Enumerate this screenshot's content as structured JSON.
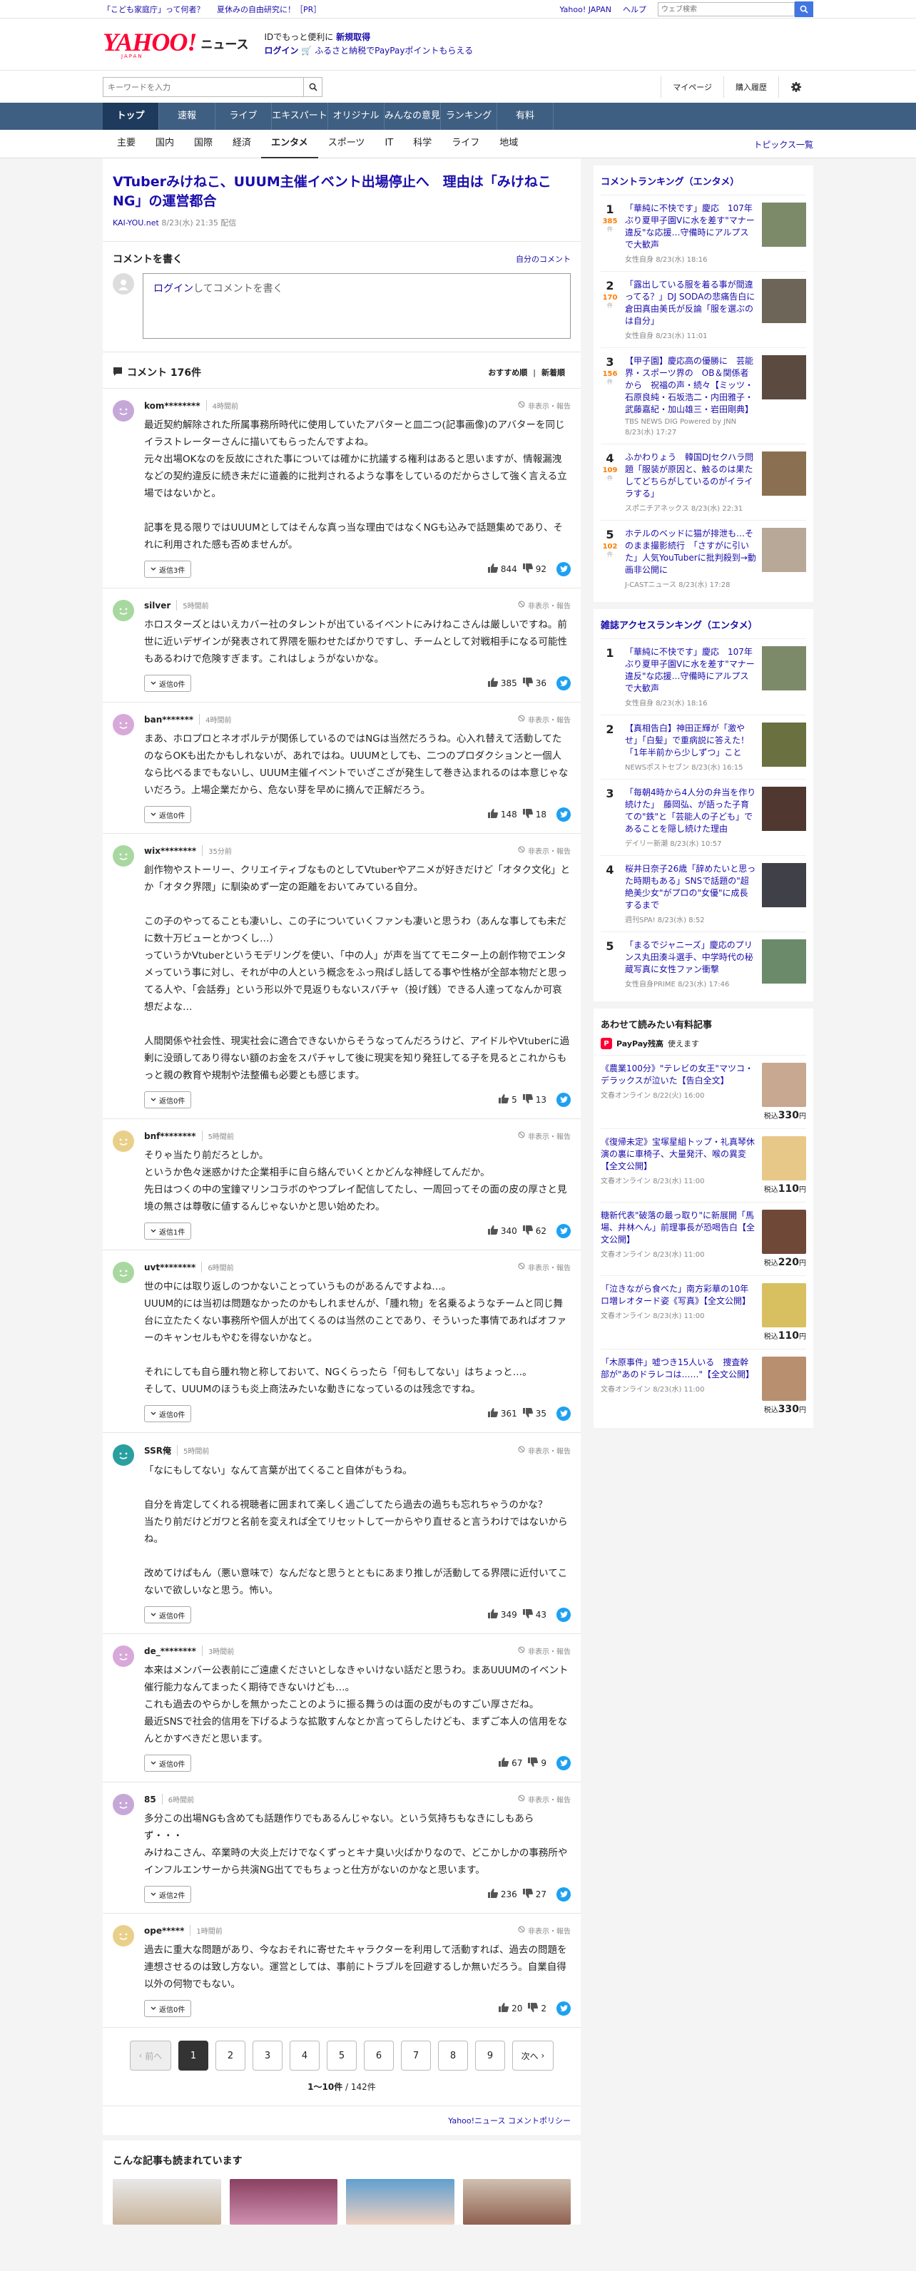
{
  "util": {
    "promo1": "「こども家庭庁」って何者？",
    "promo2": "夏休みの自由研究に！［PR］",
    "yahoo_japan": "Yahoo! JAPAN",
    "help": "ヘルプ",
    "web_search_placeholder": "ウェブ検索"
  },
  "header": {
    "logo_text": "YAHOO!",
    "logo_sub": "JAPAN",
    "logo_news": "ニュース",
    "msg_line1_a": "IDでもっと便利に",
    "msg_line1_b": "新規取得",
    "msg_line2_a": "ログイン",
    "msg_line2_b": "ふるさと納税でPayPayポイントもらえる"
  },
  "search": {
    "placeholder": "キーワードを入力",
    "mypage": "マイページ",
    "history": "購入履歴"
  },
  "gnav": [
    "トップ",
    "速報",
    "ライブ",
    "エキスパート",
    "オリジナル",
    "みんなの意見",
    "ランキング",
    "有料"
  ],
  "snav": {
    "items": [
      "主要",
      "国内",
      "国際",
      "経済",
      "エンタメ",
      "スポーツ",
      "IT",
      "科学",
      "ライフ",
      "地域"
    ],
    "topics": "トピックス一覧"
  },
  "article": {
    "title": "VTuberみけねこ、UUUM主催イベント出場停止へ　理由は「みけねこNG」の運営都合",
    "source": "KAI-YOU.net",
    "date": "8/23(水) 21:35 配信"
  },
  "comment_write": {
    "heading": "コメントを書く",
    "my_comments": "自分のコメント",
    "login": "ログイン",
    "prompt": "してコメントを書く"
  },
  "comment_list": {
    "title": "コメント 176件",
    "sort_recommended": "おすすめ順",
    "sort_new": "新着順",
    "hide_report": "非表示・報告"
  },
  "comments": [
    {
      "user": "kom********",
      "time": "4時間前",
      "text": "最近契約解除された所属事務所時代に使用していたアバターと皿二つ(記事画像)のアバターを同じイラストレーターさんに描いてもらったんですよね。\n元々出場OKなのを反故にされた事については確かに抗議する権利はあると思いますが、情報漏洩などの契約違反に続き未だに道義的に批判されるような事をしているのだからさして強く言える立場ではないかと。\n\n記事を見る限りではUUUMとしてはそんな真っ当な理由ではなくNGも込みで話題集めであり、それに利用された感も否めませんが。",
      "reply": "返信3件",
      "good": "844",
      "bad": "92",
      "color": "#c5a8d8"
    },
    {
      "user": "silver",
      "time": "5時間前",
      "text": "ホロスターズとはいえカバー社のタレントが出ているイベントにみけねこさんは厳しいですね。前世に近いデザインが発表されて界隈を賑わせたばかりですし、チームとして対戦相手になる可能性もあるわけで危険すぎます。これはしょうがないかな。",
      "reply": "返信0件",
      "good": "385",
      "bad": "36",
      "color": "#a8d8a0"
    },
    {
      "user": "ban*******",
      "time": "4時間前",
      "text": "まあ、ホロプロとネオポルテが関係しているのではNGは当然だろうね。心入れ替えて活動してたのならOKも出たかもしれないが、あれではね。UUUMとしても、二つのプロダクションと一個人なら比べるまでもないし、UUUM主催イベントでいざこざが発生して巻き込まれるのは本意じゃないだろう。上場企業だから、危ない芽を早めに摘んで正解だろう。",
      "reply": "返信0件",
      "good": "148",
      "bad": "18",
      "color": "#d8a8d8"
    },
    {
      "user": "wix********",
      "time": "35分前",
      "text": "創作物やストーリー、クリエイティブなものとしてVtuberやアニメが好きだけど「オタク文化」とか「オタク界隈」に馴染めず一定の距離をおいてみている自分。\n\nこの子のやってることも凄いし、この子についていくファンも凄いと思うわ（あんな事しても未だに数十万ビューとかつくし…）\nっていうかVtuberというモデリングを使い、「中の人」が声を当ててモニター上の創作物でエンタメっていう事に対し、それが中の人という概念をふっ飛ばし話してる事や性格が全部本物だと思ってる人や、「会話券」という形以外で見返りもないスパチャ（投げ銭）できる人達ってなんか可哀想だよな…\n\n人間関係や社会性、現実社会に適合できないからそうなってんだろうけど、アイドルやVtuberに過剰に没頭してあり得ない額のお金をスパチャして後に現実を知り発狂してる子を見るとこれからもっと親の教育や規制や法整備も必要とも感じます。",
      "reply": "返信0件",
      "good": "5",
      "bad": "13",
      "color": "#a8d8a0"
    },
    {
      "user": "bnf********",
      "time": "5時間前",
      "text": "そりゃ当たり前だろとしか。\nというか色々迷惑かけた企業相手に自ら絡んでいくとかどんな神経してんだか。\n先日はつくの中の宝鐘マリンコラボのやつプレイ配信してたし、一周回ってその面の皮の厚さと見境の無さは尊敬に値するんじゃないかと思い始めたわ。",
      "reply": "返信1件",
      "good": "340",
      "bad": "62",
      "color": "#e8d08a"
    },
    {
      "user": "uvt********",
      "time": "6時間前",
      "text": "世の中には取り返しのつかないことっていうものがあるんですよね…。\nUUUM的には当初は問題なかったのかもしれませんが、「腫れ物」を名乗るようなチームと同じ舞台に立たたくない事務所や個人が出てくるのは当然のことであり、そういった事情であればオファーのキャンセルもやむを得ないかなと。\n\nそれにしても自ら腫れ物と称しておいて、NGくらったら「何もしてない」はちょっと…。\nそして、UUUMのほうも炎上商法みたいな動きになっているのは残念ですね。",
      "reply": "返信0件",
      "good": "361",
      "bad": "35",
      "color": "#a8d8a0"
    },
    {
      "user": "SSR俺",
      "time": "5時間前",
      "text": "「なにもしてない」なんて言葉が出てくること自体がもうね。\n\n自分を肯定してくれる視聴者に囲まれて楽しく過ごしてたら過去の過ちも忘れちゃうのかな？\n当たり前だけどガワと名前を変えれば全てリセットして一からやり直せると言うわけではないからね。\n\n改めてけぱもん（悪い意味で）なんだなと思うとともにあまり推しが活動してる界隈に近付いてこないで欲しいなと思う。怖い。",
      "reply": "返信0件",
      "good": "349",
      "bad": "43",
      "color": "#2a9fa0"
    },
    {
      "user": "de_********",
      "time": "3時間前",
      "text": "本来はメンバー公表前にご遠慮くださいとしなきゃいけない話だと思うわ。まあUUUMのイベント催行能力なんてまったく期待できないけども…。\nこれも過去のやらかしを無かったことのように振る舞うのは面の皮がものすごい厚さだね。\n最近SNSで社会的信用を下げるような拡散すんなとか言ってらしたけども、まずご本人の信用をなんとかすべきだと思います。",
      "reply": "返信0件",
      "good": "67",
      "bad": "9",
      "color": "#d8a8d8"
    },
    {
      "user": "85",
      "time": "6時間前",
      "text": "多分この出場NGも含めても話題作りでもあるんじゃない。という気持ちもなきにしもあらず・・・\nみけねこさん、卒業時の大炎上だけでなくずっとキナ臭い火ばかりなので、どこかしかの事務所やインフルエンサーから共演NG出てでもちょっと仕方がないのかなと思います。",
      "reply": "返信2件",
      "good": "236",
      "bad": "27",
      "color": "#c5a8d8"
    },
    {
      "user": "ope*****",
      "time": "1時間前",
      "text": "過去に重大な問題があり、今なおそれに寄せたキャラクターを利用して活動すれば、過去の問題を連想させるのは致し方ない。運営としては、事前にトラブルを回避するしか無いだろう。自業自得以外の何物でもない。",
      "reply": "返信0件",
      "good": "20",
      "bad": "2",
      "color": "#e8d08a"
    }
  ],
  "pager": {
    "prev": "前へ",
    "next": "次へ",
    "pages": [
      "1",
      "2",
      "3",
      "4",
      "5",
      "6",
      "7",
      "8",
      "9"
    ],
    "count_range": "1〜10件",
    "count_total": "142件"
  },
  "policy": "Yahoo!ニュース コメントポリシー",
  "related": {
    "heading": "こんな記事も読まれています"
  },
  "side_ranking": {
    "heading": "コメントランキング（エンタメ）",
    "items": [
      {
        "rank": "1",
        "count": "385",
        "title": "「華純に不快です」慶応　107年ぶり夏甲子園Vに水を差す\"マナー違反\"な応援…守備時にアルプスで大歓声",
        "src": "女性自身",
        "date": "8/23(水) 18:16",
        "color": "#7d8a6a"
      },
      {
        "rank": "2",
        "count": "170",
        "title": "「露出している服を着る事が間違ってる？」DJ SODAの悲痛告白に倉田真由美氏が反論「服を選ぶのは自分」",
        "src": "女性自身",
        "date": "8/23(水) 11:01",
        "color": "#6d6658"
      },
      {
        "rank": "3",
        "count": "156",
        "title": "【甲子園】慶応高の優勝に　芸能界・スポーツ界の　OB＆関係者から　祝福の声・続々【ミッツ・石原良純・石坂浩二・内田雅子・武藤嘉紀・加山雄三・岩田剛典】",
        "src": "TBS NEWS DIG Powered by JNN",
        "date": "8/23(水) 17:27",
        "color": "#5a4a40"
      },
      {
        "rank": "4",
        "count": "109",
        "title": "ふかわりょう　韓国DJセクハラ問題「服装が原因と、触るのは果たしてどちらがしているのがイライラする」",
        "src": "スポニチアネックス",
        "date": "8/23(水) 22:31",
        "color": "#8a7050"
      },
      {
        "rank": "5",
        "count": "102",
        "title": "ホテルのベッドに猫が排泄も…そのまま撮影続行　「さすがに引いた」人気YouTuberに批判殺到→動画非公開に",
        "src": "J-CASTニュース",
        "date": "8/23(水) 17:28",
        "color": "#b8a898"
      }
    ]
  },
  "side_access": {
    "heading": "雑誌アクセスランキング（エンタメ）",
    "items": [
      {
        "rank": "1",
        "title": "「華純に不快です」慶応　107年ぶり夏甲子園Vに水を差す\"マナー違反\"な応援…守備時にアルプスで大歓声",
        "src": "女性自身",
        "date": "8/23(水) 18:16",
        "color": "#7d8a6a"
      },
      {
        "rank": "2",
        "title": "【真相告白】神田正輝が「激やせ」「白髪」で重病説に答えた！「1年半前から少しずつ」こと",
        "src": "NEWSポストセブン",
        "date": "8/23(水) 16:15",
        "color": "#6a7040"
      },
      {
        "rank": "3",
        "title": "「毎朝4時から4人分の弁当を作り続けた」　藤岡弘、が語った子育ての\"鉄\"と「芸能人の子ども」であることを隠し続けた理由",
        "src": "デイリー新潮",
        "date": "8/23(水) 10:57",
        "color": "#503830"
      },
      {
        "rank": "4",
        "title": "桜井日奈子26歳「辞めたいと思った時期もある」SNSで話題の\"超絶美少女\"がプロの\"女優\"に成長するまで",
        "src": "週刊SPA!",
        "date": "8/23(水) 8:52",
        "color": "#404048"
      },
      {
        "rank": "5",
        "title": "「まるでジャニーズ」慶応のプリンス丸田湊斗選手、中学時代の秘蔵写真に女性ファン衝撃",
        "src": "女性自身PRIME",
        "date": "8/23(水) 17:46",
        "color": "#6a8a6a"
      }
    ]
  },
  "side_paid": {
    "heading": "あわせて読みたい有料記事",
    "paypay": "PayPay残高",
    "paypay_sub": "使えます",
    "items": [
      {
        "title": "《農業100分》\"テレビの女王\"マツコ・デラックスが泣いた【告白全文】",
        "src": "文春オンライン",
        "date": "8/22(火) 16:00",
        "price": "330",
        "color": "#c8a890"
      },
      {
        "title": "《復帰未定》宝塚星組トップ・礼真琴休演の裏に車椅子、大量発汗、喉の異変【全文公開】",
        "src": "文春オンライン",
        "date": "8/23(水) 11:00",
        "price": "110",
        "color": "#e8c888"
      },
      {
        "title": "糖新代表\"破落の最っ取り\"に新展開「馬場、井林へん」前理事長が恐喝告白【全文公開】",
        "src": "文春オンライン",
        "date": "8/23(水) 11:00",
        "price": "220",
        "color": "#704838"
      },
      {
        "title": "「泣きながら食べた」南方彩華の10年ロ増レオタード姿《写真》【全文公開】",
        "src": "文春オンライン",
        "date": "8/23(水) 11:00",
        "price": "110",
        "color": "#d8c060"
      },
      {
        "title": "「木原事件」嘘つき15人いる　捜査幹部が\"あのドラレコは……\"【全文公開】",
        "src": "文春オンライン",
        "date": "8/23(水) 11:00",
        "price": "330",
        "color": "#b89070"
      }
    ],
    "tax_label": "税込",
    "yen": "円"
  },
  "colors": {
    "brand_red": "#ff0033",
    "nav_blue": "#3f5f82",
    "link_blue": "#1a0dab",
    "twitter": "#1da1f2"
  }
}
